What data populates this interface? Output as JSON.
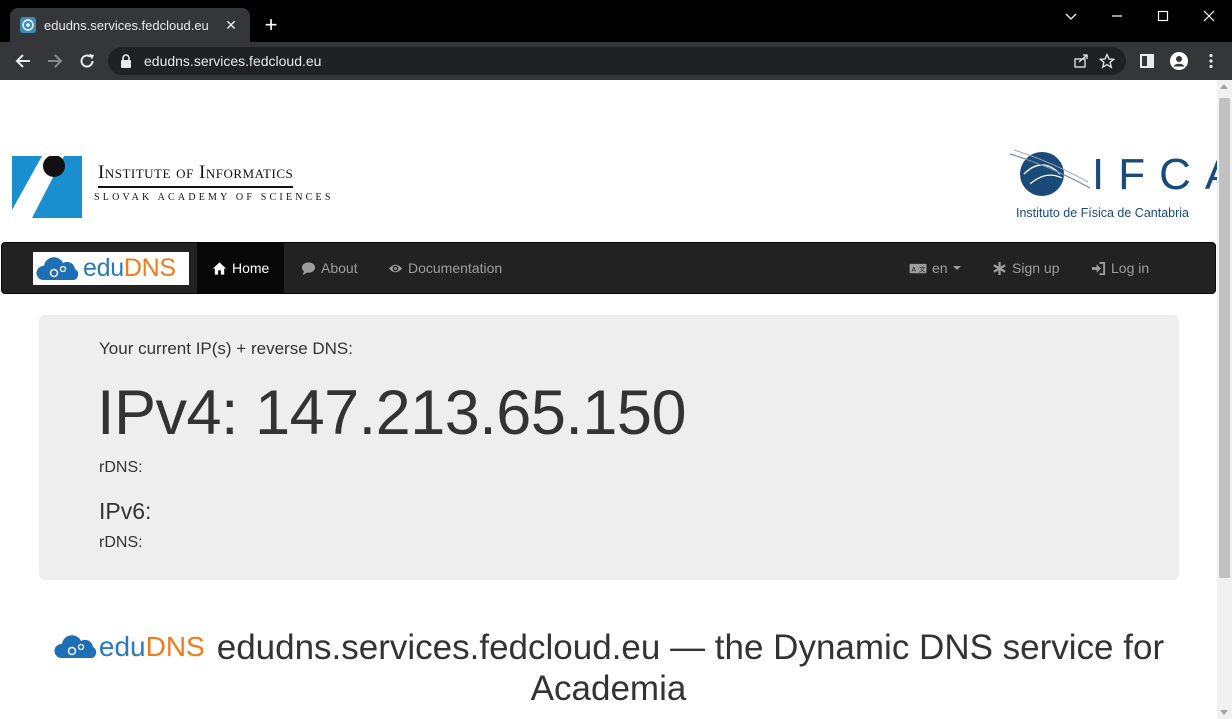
{
  "browser": {
    "tab_title": "edudns.services.fedcloud.eu",
    "url": "edudns.services.fedcloud.eu"
  },
  "header": {
    "left_logo": {
      "name": "Institute of Informatics",
      "subtitle": "SLOVAK ACADEMY OF SCIENCES"
    },
    "right_logo": {
      "letters": "IFCA",
      "subtitle": "Instituto de Física de Cantabria"
    }
  },
  "navbar": {
    "brand": {
      "edu": "edu",
      "dns": "DNS"
    },
    "items": [
      {
        "label": "Home",
        "icon": "home-icon",
        "active": true
      },
      {
        "label": "About",
        "icon": "comment-icon",
        "active": false
      },
      {
        "label": "Documentation",
        "icon": "eye-icon",
        "active": false
      }
    ],
    "right_items": [
      {
        "label": "en",
        "icon": "language-icon"
      },
      {
        "label": "Sign up",
        "icon": "asterisk-icon"
      },
      {
        "label": "Log in",
        "icon": "login-icon"
      }
    ]
  },
  "jumbotron": {
    "lead": "Your current IP(s) + reverse DNS:",
    "ipv4": "IPv4: 147.213.65.150",
    "rdns1": "rDNS:",
    "ipv6": "IPv6:",
    "rdns2": "rDNS:"
  },
  "heading": {
    "logo_edu": "edu",
    "logo_dns": "DNS",
    "text": "edudns.services.fedcloud.eu — the Dynamic DNS service for Academia"
  },
  "colors": {
    "brand_blue": "#2a7ab8",
    "brand_orange": "#f07b1d",
    "navbar_bg": "#222222",
    "jumbotron_bg": "#eeeeee",
    "ifca_blue": "#1a4a7a"
  }
}
